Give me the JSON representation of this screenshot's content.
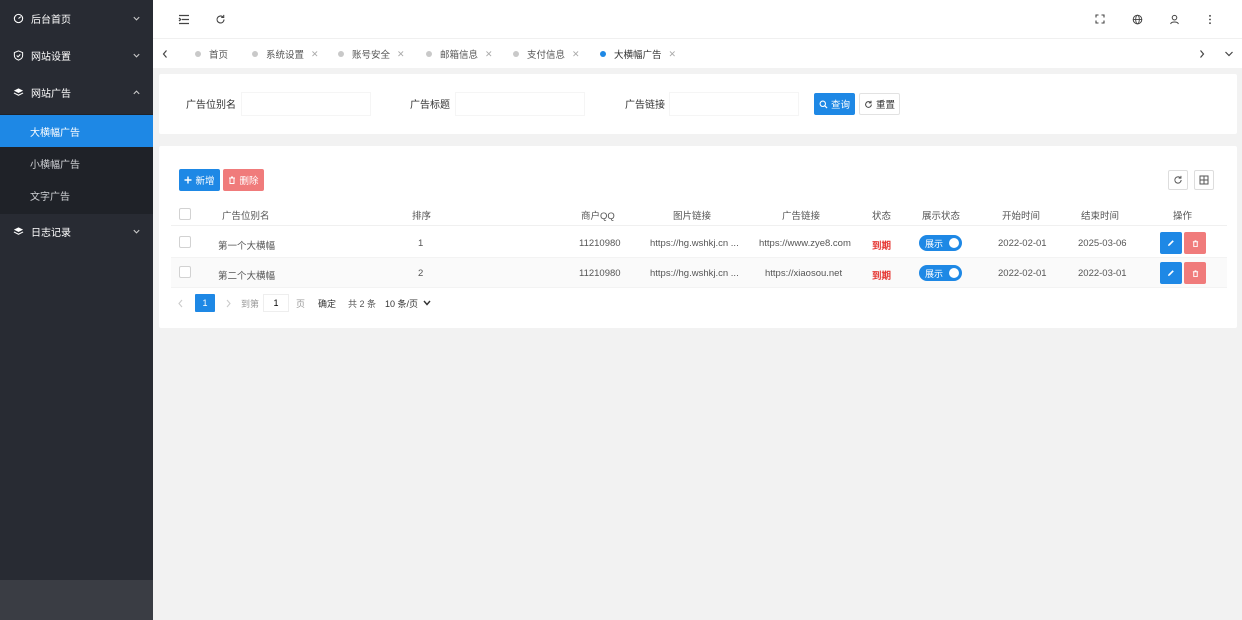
{
  "sidebar": {
    "menu": [
      {
        "label": "后台首页",
        "icon": "dashboard-icon",
        "expanded": false
      },
      {
        "label": "网站设置",
        "icon": "shield-icon",
        "expanded": false
      },
      {
        "label": "网站广告",
        "icon": "layers-icon",
        "expanded": true
      },
      {
        "label": "日志记录",
        "icon": "layers-icon",
        "expanded": false
      }
    ],
    "submenu": [
      "大横幅广告",
      "小横幅广告",
      "文字广告"
    ],
    "active_submenu": "大横幅广告"
  },
  "header": {
    "left_icons": [
      "menu-toggle-icon",
      "refresh-icon"
    ],
    "right_icons": [
      "fullscreen-icon",
      "globe-icon",
      "user-icon",
      "more-vertical-icon"
    ]
  },
  "tabs": {
    "items": [
      {
        "label": "首页",
        "closable": false
      },
      {
        "label": "系统设置",
        "closable": true
      },
      {
        "label": "账号安全",
        "closable": true
      },
      {
        "label": "邮箱信息",
        "closable": true
      },
      {
        "label": "支付信息",
        "closable": true
      },
      {
        "label": "大横幅广告",
        "closable": true,
        "active": true
      }
    ]
  },
  "search": {
    "fields": [
      {
        "label": "广告位别名",
        "value": ""
      },
      {
        "label": "广告标题",
        "value": ""
      },
      {
        "label": "广告链接",
        "value": ""
      }
    ],
    "query_label": "查询",
    "reset_label": "重置"
  },
  "toolbar": {
    "add_label": "新增",
    "delete_label": "删除"
  },
  "table": {
    "columns": [
      "广告位别名",
      "排序",
      "商户QQ",
      "图片链接",
      "广告链接",
      "状态",
      "展示状态",
      "开始时间",
      "结束时间",
      "操作"
    ],
    "rows": [
      {
        "name": "第一个大横幅",
        "order": "1",
        "qq": "11210980",
        "image_url": "https://hg.wshkj.cn ...",
        "ad_url": "https://www.zye8.com",
        "status": "到期",
        "display": "展示",
        "start": "2022-02-01",
        "end": "2025-03-06"
      },
      {
        "name": "第二个大横幅",
        "order": "2",
        "qq": "11210980",
        "image_url": "https://hg.wshkj.cn ...",
        "ad_url": "https://xiaosou.net",
        "status": "到期",
        "display": "展示",
        "start": "2022-02-01",
        "end": "2022-03-01"
      }
    ]
  },
  "pagination": {
    "current_page": "1",
    "goto_label": "到第",
    "goto_value": "1",
    "page_unit": "页",
    "confirm_label": "确定",
    "total_label": "共 2 条",
    "page_size_label": "10 条/页"
  },
  "colors": {
    "sidebar_bg": "#282b33",
    "accent": "#1e88e5",
    "danger": "#f07b7b",
    "status_red": "#e53935"
  }
}
